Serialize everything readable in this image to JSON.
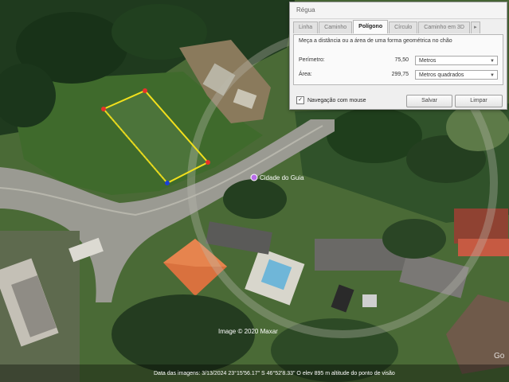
{
  "dialog": {
    "title": "Régua",
    "tabs": [
      "Linha",
      "Caminho",
      "Polígono",
      "Círculo",
      "Caminho em 3D"
    ],
    "active_tab": "Polígono",
    "more_tabs": "▸",
    "description": "Meça a distância ou a área de uma forma geométrica no chão",
    "perimeter": {
      "label": "Perímetro:",
      "value": "75,50",
      "unit": "Metros"
    },
    "area": {
      "label": "Área:",
      "value": "299,75",
      "unit": "Metros quadrados"
    },
    "mouse_nav": {
      "checked": true,
      "label": "Navegação com mouse"
    },
    "save_button": "Salvar",
    "clear_button": "Limpar"
  },
  "map": {
    "place_label": "Cidade do Guia",
    "copyright": "Image © 2020 Maxar",
    "status_bar": "Data das imagens: 3/13/2024    23°15'56.17\" S    46°52'8.33\" O   elev   895 m   altitude do ponto de visão",
    "logo": "Go"
  },
  "colors": {
    "polygon_edge": "#f2e01c",
    "vertex": "#e8332a",
    "last_vertex": "#1a40d8",
    "accent_tab": "#fafafa"
  }
}
